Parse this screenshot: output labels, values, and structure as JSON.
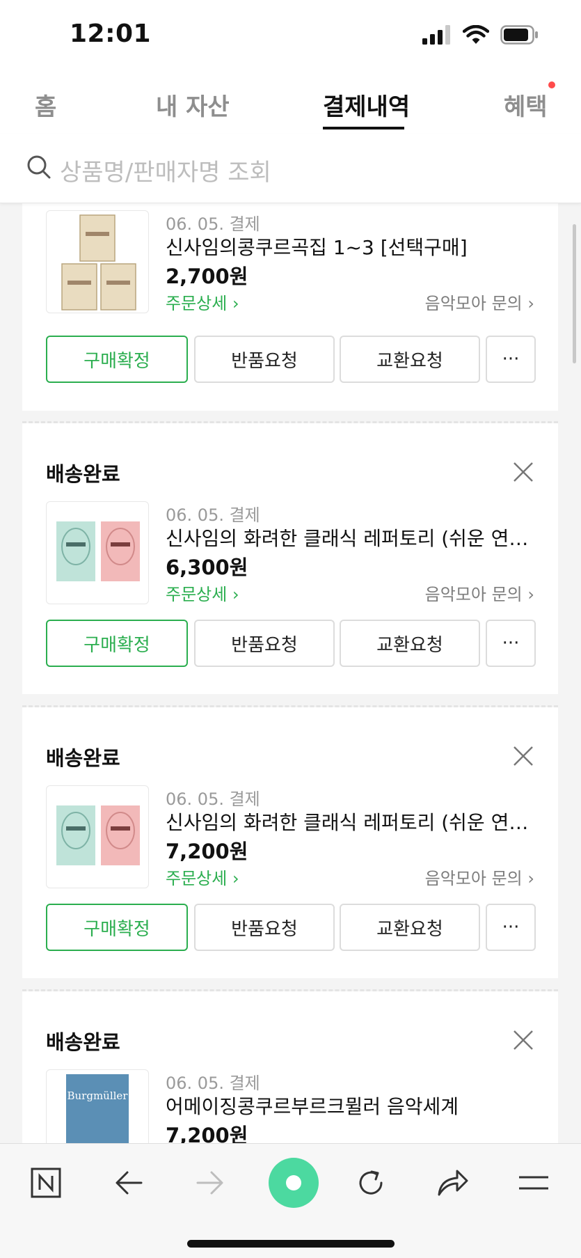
{
  "status_bar": {
    "time": "12:01"
  },
  "tabs": [
    {
      "label": "홈",
      "active": false
    },
    {
      "label": "내 자산",
      "active": false
    },
    {
      "label": "결제내역",
      "active": true
    },
    {
      "label": "혜택",
      "active": false,
      "has_badge": true
    }
  ],
  "search": {
    "placeholder": "상품명/판매자명 조회"
  },
  "orders": [
    {
      "status": "",
      "date": "06. 05. 결제",
      "product": "신사임의콩쿠르곡집 1~3 [선택구매]",
      "price": "2,700원",
      "detail_link": "주문상세",
      "inquiry_link": "음악모아 문의",
      "buttons": {
        "confirm": "구매확정",
        "return": "반품요청",
        "exchange": "교환요청",
        "more": "···"
      }
    },
    {
      "status": "배송완료",
      "date": "06. 05. 결제",
      "product": "신사임의 화려한 클래식 레퍼토리 (쉬운 연주편...",
      "price": "6,300원",
      "detail_link": "주문상세",
      "inquiry_link": "음악모아 문의",
      "buttons": {
        "confirm": "구매확정",
        "return": "반품요청",
        "exchange": "교환요청",
        "more": "···"
      }
    },
    {
      "status": "배송완료",
      "date": "06. 05. 결제",
      "product": "신사임의 화려한 클래식 레퍼토리 (쉬운 연주편...",
      "price": "7,200원",
      "detail_link": "주문상세",
      "inquiry_link": "음악모아 문의",
      "buttons": {
        "confirm": "구매확정",
        "return": "반품요청",
        "exchange": "교환요청",
        "more": "···"
      }
    },
    {
      "status": "배송완료",
      "date": "06. 05. 결제",
      "product": "어메이징콩쿠르부르크뮐러 음악세계",
      "price": "7,200원",
      "thumb_text": "Burgmüller"
    }
  ],
  "colors": {
    "accent_green": "#2bae4f",
    "badge_red": "#ff4b4b",
    "browser_green": "#4cd9a0"
  },
  "icons": [
    "search-icon",
    "close-icon",
    "naver-n-icon",
    "back-arrow-icon",
    "forward-arrow-icon",
    "green-dot-icon",
    "refresh-icon",
    "share-icon",
    "menu-icon"
  ]
}
